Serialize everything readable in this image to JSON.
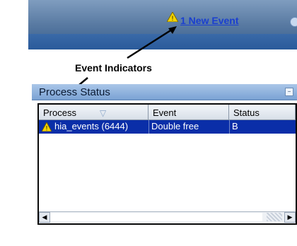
{
  "header": {
    "event_link": "1 New Event"
  },
  "annotation": {
    "label": "Event Indicators"
  },
  "panel": {
    "title": "Process Status",
    "columns": [
      "Process",
      "Event",
      "Status"
    ],
    "rows": [
      {
        "process": "hia_events (6444)",
        "event": "Double free",
        "status": "B"
      }
    ]
  },
  "colors": {
    "header_blue": "#2a5a9a",
    "link_blue": "#1a3fd0",
    "selected_row": "#0a2ea8",
    "warning_yellow": "#f5d400"
  }
}
